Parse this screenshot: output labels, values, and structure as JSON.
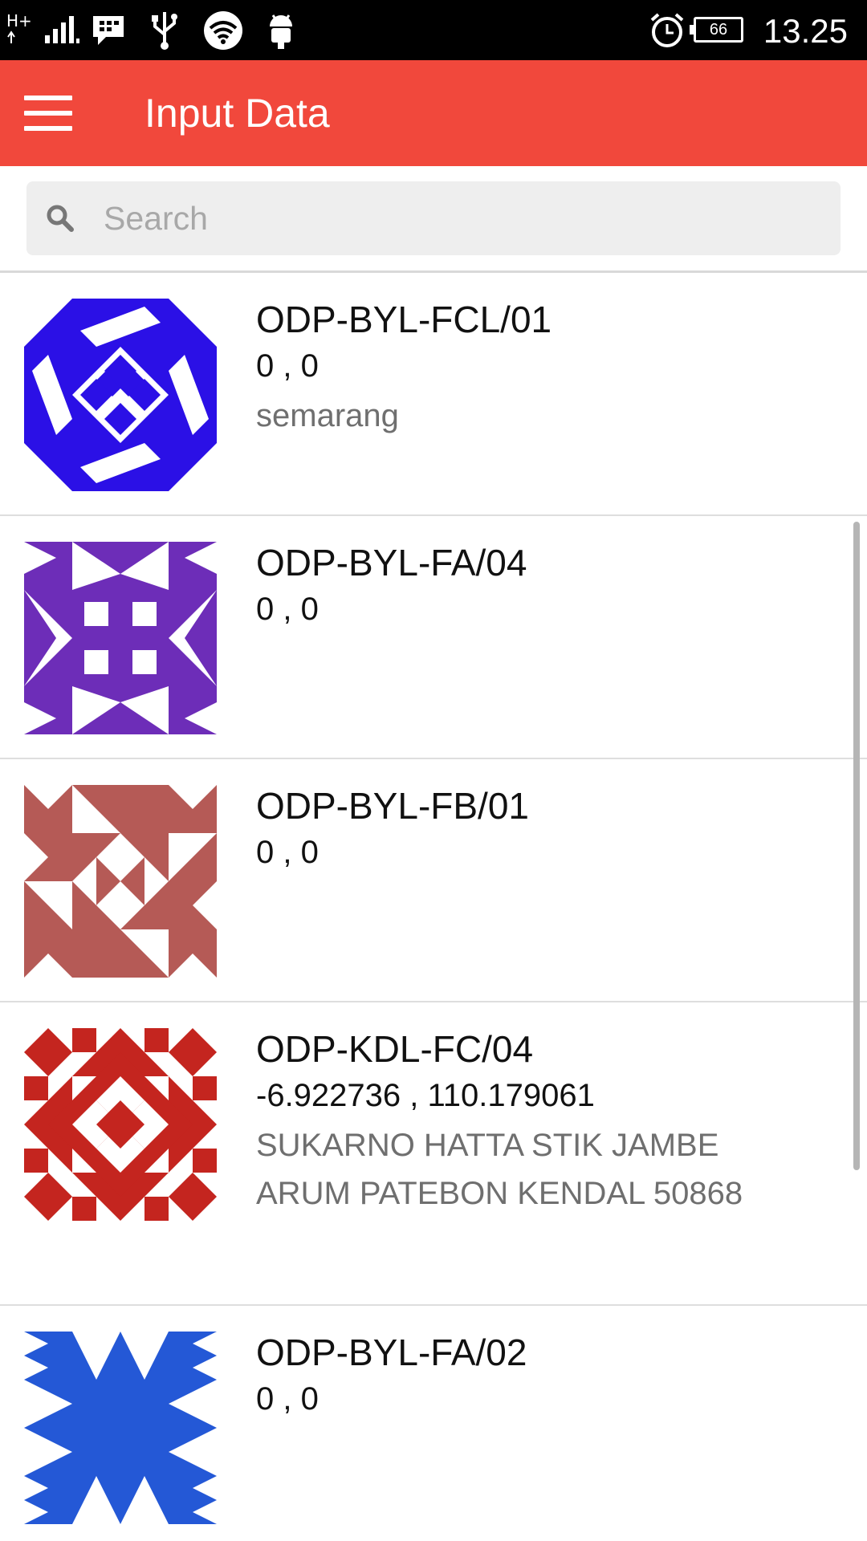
{
  "status_bar": {
    "network": "H+",
    "battery": "66",
    "time": "13.25"
  },
  "app_bar": {
    "title": "Input Data"
  },
  "search": {
    "placeholder": "Search"
  },
  "items": [
    {
      "name": "ODP-BYL-FCL/01",
      "coords": "0 , 0",
      "address": "semarang",
      "avatar_color": "#2b10e6"
    },
    {
      "name": "ODP-BYL-FA/04",
      "coords": "0 , 0",
      "address": "",
      "avatar_color": "#6d2db8"
    },
    {
      "name": "ODP-BYL-FB/01",
      "coords": "0 , 0",
      "address": "",
      "avatar_color": "#b55a56"
    },
    {
      "name": "ODP-KDL-FC/04",
      "coords": "-6.922736 , 110.179061",
      "address": "SUKARNO HATTA STIK JAMBE ARUM PATEBON KENDAL 50868",
      "avatar_color": "#c4251f"
    },
    {
      "name": "ODP-BYL-FA/02",
      "coords": "0 , 0",
      "address": "",
      "avatar_color": "#2458d6"
    }
  ]
}
